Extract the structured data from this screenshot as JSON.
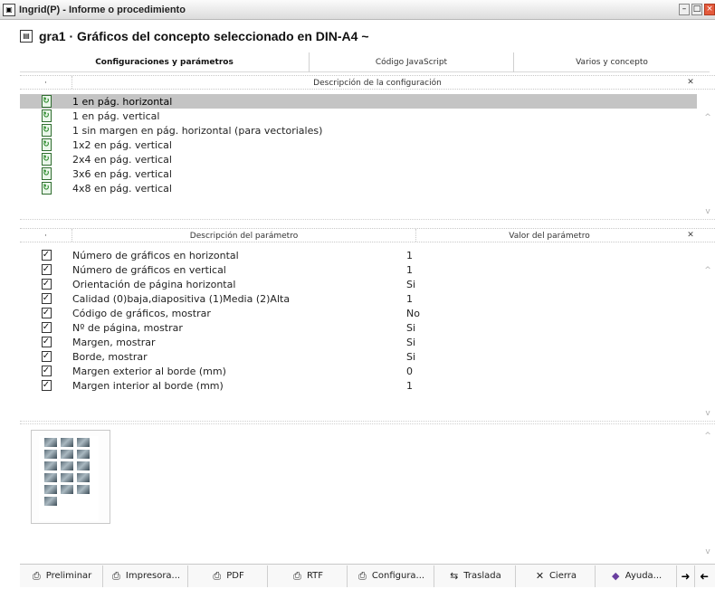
{
  "window": {
    "title": "Ingrid(P) - Informe o procedimiento",
    "app_icon": "app-icon",
    "buttons": [
      "minimize-icon",
      "maximize-icon",
      "close-icon"
    ]
  },
  "heading": {
    "text": "gra1 · Gráficos del concepto seleccionado en DIN-A4 ~",
    "icon": "document-icon"
  },
  "tabs": [
    {
      "label": "Configuraciones y parámetros",
      "active": true
    },
    {
      "label": "Código JavaScript",
      "active": false
    },
    {
      "label": "Varios y concepto",
      "active": false
    }
  ],
  "config_table": {
    "dot_header": "·",
    "column_header": "Descripción de la configuración",
    "sort_icon": "sort-icon",
    "rows": [
      {
        "label": "1 en pág. horizontal",
        "selected": true,
        "icon": "refresh-icon"
      },
      {
        "label": "1 en pág. vertical",
        "selected": false,
        "icon": "refresh-icon"
      },
      {
        "label": "1 sin margen en pág. horizontal (para vectoriales)",
        "selected": false,
        "icon": "refresh-icon"
      },
      {
        "label": "1x2 en pág. vertical",
        "selected": false,
        "icon": "refresh-icon"
      },
      {
        "label": "2x4 en pág. vertical",
        "selected": false,
        "icon": "refresh-icon"
      },
      {
        "label": "3x6 en pág. vertical",
        "selected": false,
        "icon": "refresh-icon"
      },
      {
        "label": "4x8 en pág. vertical",
        "selected": false,
        "icon": "refresh-icon"
      }
    ]
  },
  "param_table": {
    "dot_header": "·",
    "desc_header": "Descripción del parámetro",
    "value_header": "Valor del parámetro",
    "sort_icon": "sort-icon",
    "rows": [
      {
        "desc": "Número de gráficos en horizontal",
        "value": "1"
      },
      {
        "desc": "Número de gráficos en vertical",
        "value": "1"
      },
      {
        "desc": "Orientación de página horizontal",
        "value": "Si"
      },
      {
        "desc": "Calidad (0)baja,diapositiva (1)Media (2)Alta",
        "value": "1"
      },
      {
        "desc": "Código de gráficos, mostrar",
        "value": "No"
      },
      {
        "desc": "Nº de página, mostrar",
        "value": "Si"
      },
      {
        "desc": "Margen, mostrar",
        "value": "Si"
      },
      {
        "desc": "Borde, mostrar",
        "value": "Si"
      },
      {
        "desc": "Margen exterior al borde (mm)",
        "value": "0"
      },
      {
        "desc": "Margen interior al borde (mm)",
        "value": "1"
      }
    ]
  },
  "toolbar": {
    "buttons": [
      {
        "label": "Preliminar",
        "icon": "printer-icon"
      },
      {
        "label": "Impresora...",
        "icon": "printer-icon"
      },
      {
        "label": "PDF",
        "icon": "pdf-printer-icon"
      },
      {
        "label": "RTF",
        "icon": "rtf-printer-icon"
      },
      {
        "label": "Configura...",
        "icon": "printer-settings-icon"
      },
      {
        "label": "Traslada",
        "icon": "transfer-icon"
      },
      {
        "label": "Cierra",
        "icon": "close-x-icon"
      },
      {
        "label": "Ayuda...",
        "icon": "help-book-icon"
      }
    ],
    "arrows": [
      "arrow-right-icon",
      "arrow-left-icon"
    ]
  }
}
